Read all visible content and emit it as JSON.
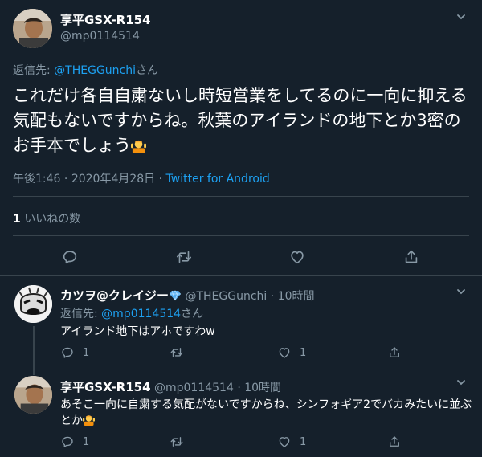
{
  "main_tweet": {
    "display_name": "享平GSX-R154",
    "handle": "@mp0114514",
    "reply_prefix": "返信先: ",
    "reply_handle": "@THEGGunchi",
    "reply_suffix": "さん",
    "text": "これだけ各自自粛ないし時短営業をしてるのに一向に抑える気配もないですからね。秋葉のアイランドの地下とか3密のお手本でしょう",
    "time": "午後1:46",
    "dot": "·",
    "date": "2020年4月28日",
    "source": "Twitter for Android",
    "likes_count": "1",
    "likes_label": "いいねの数"
  },
  "replies": [
    {
      "display_name": "カツヲ@クレイジー",
      "handle": "@THEGGunchi",
      "dot": "·",
      "time": "10時間",
      "reply_prefix": "返信先: ",
      "reply_handle": "@mp0114514",
      "reply_suffix": "さん",
      "text": "アイランド地下はアホですわw",
      "reply_count": "1",
      "retweet_count": "",
      "like_count": "1"
    },
    {
      "display_name": "享平GSX-R154",
      "handle": "@mp0114514",
      "dot": "·",
      "time": "10時間",
      "text": "あそこ一向に自粛する気配がないですからね、シンフォギア2でバカみたいに並ぶとか",
      "reply_count": "1",
      "retweet_count": "",
      "like_count": "1"
    }
  ],
  "icons": [
    "chevron-down-icon",
    "reply-icon",
    "retweet-icon",
    "like-icon",
    "share-icon",
    "shrug-emoji",
    "diamond-emoji"
  ],
  "colors": {
    "background": "#15202b",
    "text": "#ffffff",
    "muted": "#8899a6",
    "link": "#1da1f2",
    "divider": "#38444d"
  }
}
